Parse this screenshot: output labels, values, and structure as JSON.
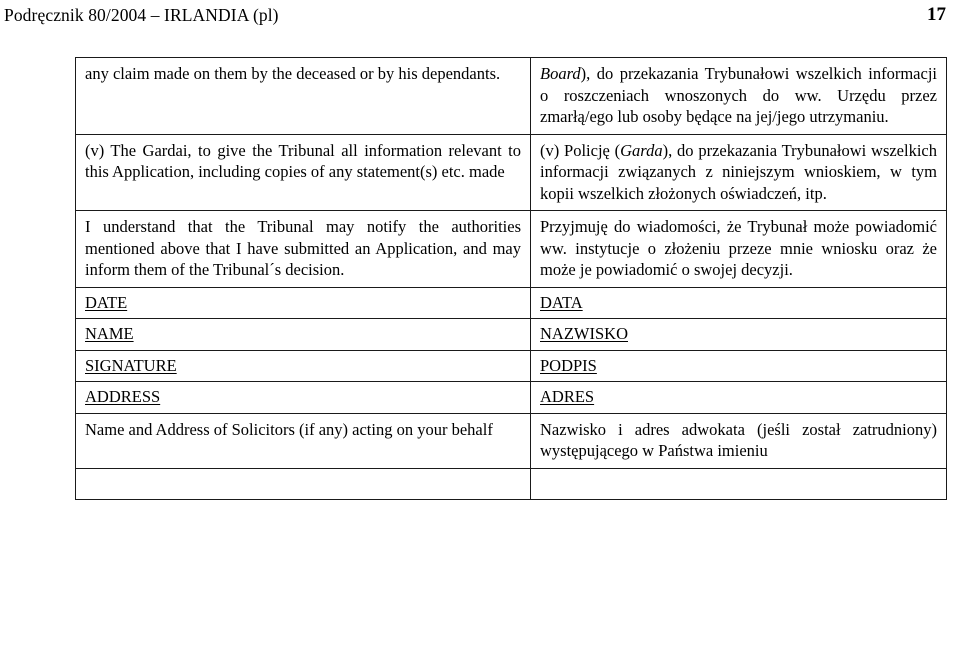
{
  "header": {
    "title": "Podręcznik 80/2004 – IRLANDIA (pl)",
    "page_number": "17"
  },
  "table": {
    "rows": [
      {
        "id": "row-claim-continuation",
        "type": "paragraph",
        "en": "any claim made on them by the deceased or by his dependants.",
        "pl_lead_italic": "Board",
        "pl": "), do przekazania Trybunałowi wszelkich informacji o roszczeniach wnoszonych do ww. Urzędu przez zmarłą/ego lub osoby będące na jej/jego utrzymaniu."
      },
      {
        "id": "row-item-v-gardai",
        "type": "paragraph",
        "en": "(v) The Gardai, to give the Tribunal all information relevant to this Application, including copies of any statement(s) etc. made",
        "pl_part1": "(v)   Policję   (",
        "pl_italic": "Garda",
        "pl_part2": "),   do   przekazania Trybunałowi wszelkich informacji związanych z   niniejszym   wnioskiem,   w   tym   kopii wszelkich złożonych oświadczeń, itp."
      },
      {
        "id": "row-understanding",
        "type": "paragraph",
        "en": "I understand that the Tribunal may notify the authorities mentioned above that I have submitted an Application, and may inform them of the Tribunal´s decision.",
        "pl": "Przyjmuję do wiadomości, że Trybunał może powiadomić ww. instytucje o złożeniu przeze mnie wniosku oraz że może je powiadomić o swojej decyzji."
      },
      {
        "id": "row-date",
        "type": "label",
        "en": "DATE",
        "pl": "DATA"
      },
      {
        "id": "row-name",
        "type": "label",
        "en": "NAME",
        "pl": "NAZWISKO"
      },
      {
        "id": "row-signature",
        "type": "label",
        "en": "SIGNATURE",
        "pl": "PODPIS"
      },
      {
        "id": "row-address",
        "type": "label",
        "en": "ADDRESS",
        "pl": "ADRES"
      },
      {
        "id": "row-solicitors",
        "type": "paragraph",
        "en": "Name and Address of Solicitors (if any) acting on your behalf",
        "pl": "Nazwisko   i   adres   adwokata   (jeśli   został zatrudniony)   występującego   w   Państwa imieniu"
      },
      {
        "id": "row-blank",
        "type": "empty",
        "en": "",
        "pl": ""
      }
    ]
  }
}
